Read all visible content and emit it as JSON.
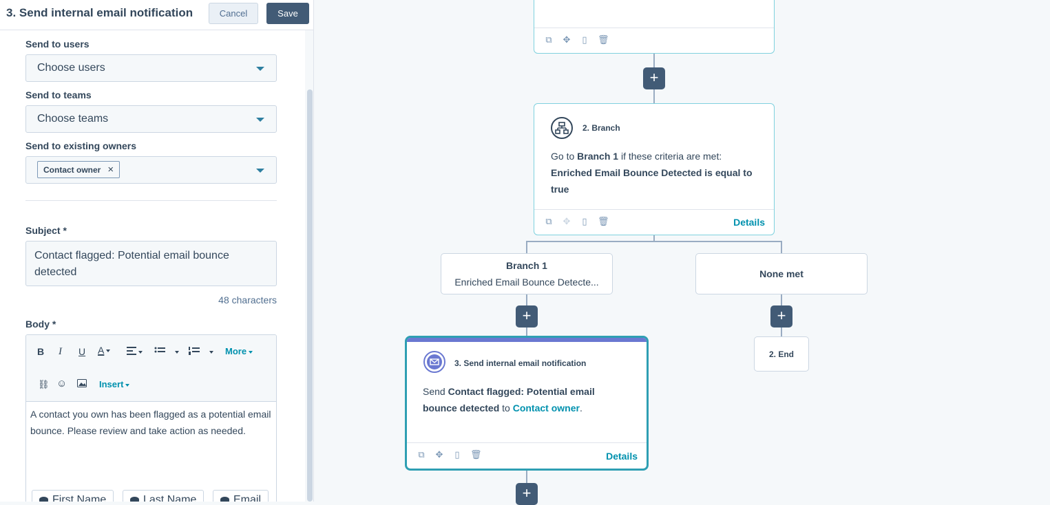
{
  "panel": {
    "title": "3. Send internal email notification",
    "cancel_label": "Cancel",
    "save_label": "Save",
    "send_to_users_label": "Send to users",
    "send_to_users_value": "Choose users",
    "send_to_teams_label": "Send to teams",
    "send_to_teams_value": "Choose teams",
    "send_to_owners_label": "Send to existing owners",
    "owner_tag": "Contact owner",
    "owner_tag_remove": "×",
    "subject_label": "Subject *",
    "subject_value": "Contact flagged: Potential email bounce detected",
    "char_count": "48 characters",
    "body_label": "Body *",
    "toolbar": {
      "bold": "B",
      "italic": "I",
      "underline": "U",
      "font_color": "A",
      "more": "More",
      "insert": "Insert"
    },
    "body_text": "A contact you own has been flagged as a potential email bounce. Please review and take action as needed.",
    "tokens": [
      "First Name",
      "Last Name",
      "Email"
    ]
  },
  "canvas": {
    "branch_card": {
      "title": "2. Branch",
      "text_prefix": "Go to ",
      "branch_name": "Branch 1",
      "text_mid": " if these criteria are met:",
      "criteria": "Enriched Email Bounce Detected is equal to true",
      "details": "Details"
    },
    "branch1": {
      "title": "Branch 1",
      "subtitle": "Enriched Email Bounce Detecte..."
    },
    "none_met": "None met",
    "end_label": "2. End",
    "email_card": {
      "title": "3. Send internal email notification",
      "send_word": "Send ",
      "subject": "Contact flagged: Potential email bounce detected",
      "to_word": " to ",
      "recipient": "Contact owner",
      "period": ".",
      "details": "Details"
    },
    "plus_symbol": "+"
  },
  "colors": {
    "accent": "#0091ae",
    "dark_button": "#425b76",
    "selected_card": "#2e9fb3",
    "card_top_bar": "#6a78d1"
  }
}
